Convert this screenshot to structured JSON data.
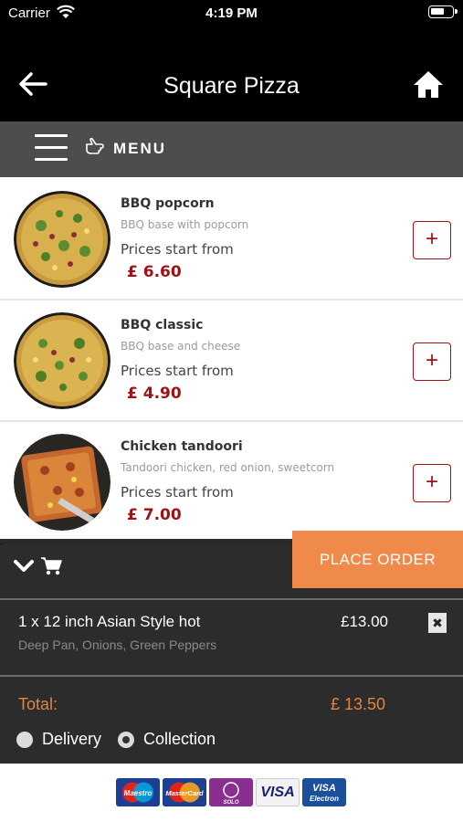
{
  "status": {
    "carrier": "Carrier",
    "time": "4:19 PM"
  },
  "nav": {
    "title": "Square Pizza"
  },
  "menu_bar": {
    "label": "MENU"
  },
  "menu_items": [
    {
      "name": "BBQ popcorn",
      "description": "BBQ base with popcorn",
      "price_prefix": "Prices start from",
      "price": "£ 6.60",
      "add_label": "+"
    },
    {
      "name": "BBQ classic",
      "description": "BBQ base and cheese",
      "price_prefix": "Prices start from",
      "price": "£ 4.90",
      "add_label": "+"
    },
    {
      "name": "Chicken tandoori",
      "description": "Tandoori chicken, red onion, sweetcorn",
      "price_prefix": "Prices start from",
      "price": "£ 7.00",
      "add_label": "+"
    }
  ],
  "basket": {
    "place_order_label": "PLACE ORDER",
    "line": {
      "name": "1 x 12 inch Asian Style hot",
      "price": "£13.00",
      "options": "Deep Pan, Onions, Green Peppers",
      "remove_label": "✖"
    },
    "total_label": "Total:",
    "total_value": "£ 13.50",
    "delivery_label": "Delivery",
    "collection_label": "Collection",
    "selected_option": "Collection"
  },
  "payment_cards": [
    {
      "name": "Maestro"
    },
    {
      "name": "MasterCard"
    },
    {
      "name": "SOLO"
    },
    {
      "name": "VISA"
    },
    {
      "name": "VISA Electron"
    }
  ],
  "colors": {
    "accent_red": "#a10f17",
    "place_order_orange": "#f08a4b",
    "total_orange": "#e1843f"
  }
}
